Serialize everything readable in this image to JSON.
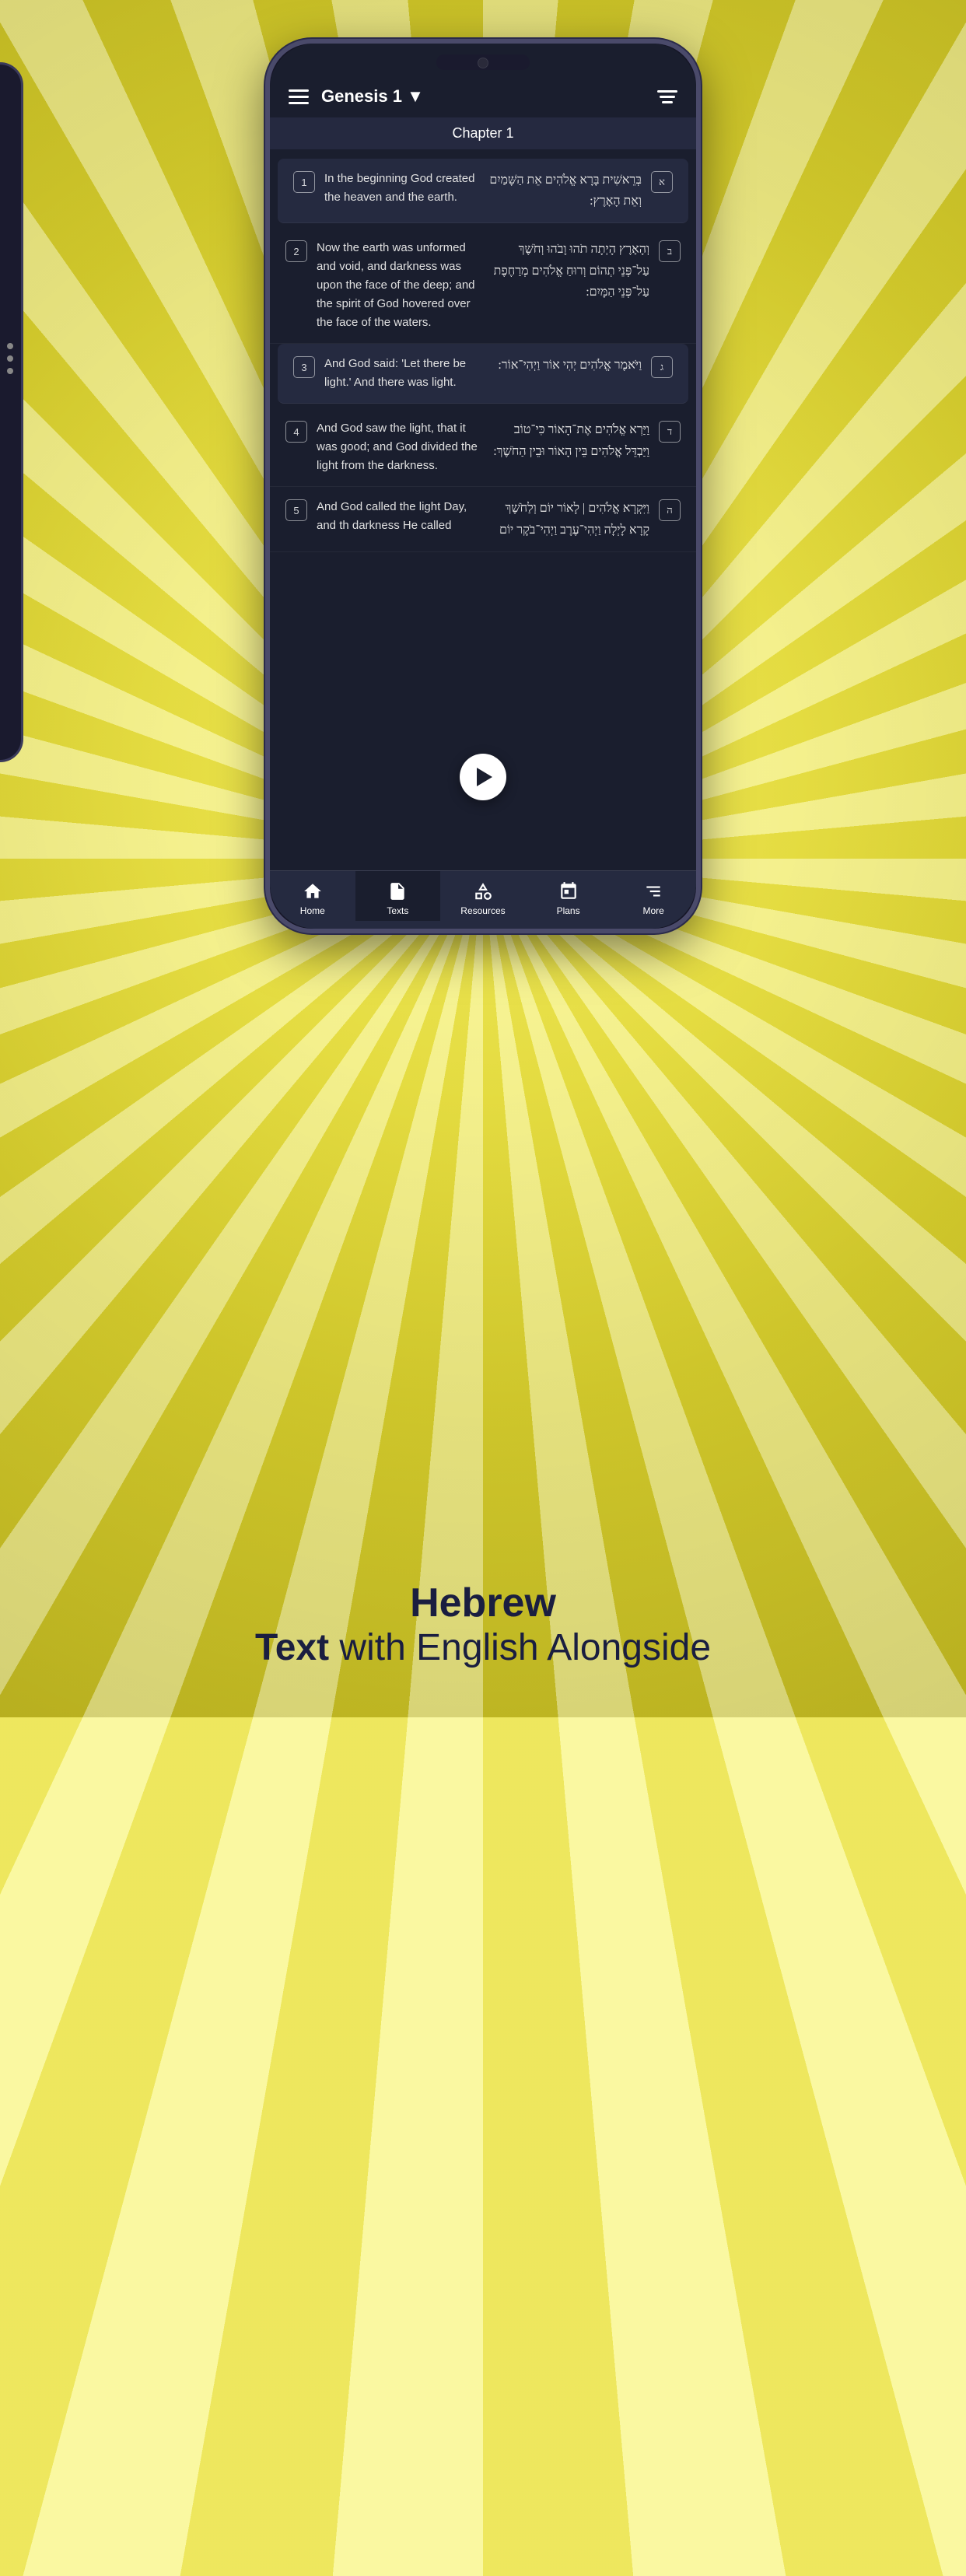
{
  "background": {
    "color": "#f0ed5a"
  },
  "phone": {
    "header": {
      "menu_icon": "≡",
      "title": "Genesis 1",
      "dropdown_label": "Genesis 1 ▼",
      "filter_icon": "filter"
    },
    "chapter": {
      "label": "Chapter 1"
    },
    "verses": [
      {
        "number": "1",
        "hebrew_letter": "א",
        "english": "In the beginning God created the heaven and the earth.",
        "hebrew": "בְּרֵאשִׁית בָּרָא אֱלֹהִים אֵת הַשָּׁמַיִם וְאֵת הָאָרֶץ:",
        "highlighted": true
      },
      {
        "number": "2",
        "hebrew_letter": "ב",
        "english": "Now the earth was unformed and void, and darkness was upon the face of the deep; and the spirit of God hovered over the face of the waters.",
        "hebrew": "וְהָאָרֶץ הָיְתָה תֹהוּ וָבֹהוּ וְחֹשֶׁךְ עַל־פְּנֵי תְהוֹם וְרוּחַ אֱלֹהִים מְרַחֶפֶת עַל־פְּנֵי הַמָּיִם:",
        "highlighted": false
      },
      {
        "number": "3",
        "hebrew_letter": "ג",
        "english": "And God said: 'Let there be light.' And there was light.",
        "hebrew": "וַיֹּאמֶר אֱלֹהִים יְהִי אוֹר וַיְהִי־אוֹר:",
        "highlighted": true
      },
      {
        "number": "4",
        "hebrew_letter": "ד",
        "english": "And God saw the light, that it was good; and God divided the light from the darkness.",
        "hebrew": "וַיַּרְא אֱלֹהִים אֶת־הָאוֹר כִּי־טוֹב וַיַּבְדֵּל אֱלֹהִים בֵּין הָאוֹר וּבֵין הַחֹשֶׁךְ:",
        "highlighted": false
      },
      {
        "number": "5",
        "hebrew_letter": "ה",
        "english": "And God called the light Day, and th darkness He called",
        "hebrew": "וַיִּקְרָא אֱלֹהִים | לָאוֹר יוֹם וְלַחֹשֶׁךְ קָרָא לָיְלָה וַיְהִי־עֶרֶב וַיְהִי־בֹקֶר יוֹם",
        "highlighted": false
      }
    ],
    "nav": [
      {
        "label": "Home",
        "icon": "home",
        "active": false
      },
      {
        "label": "Texts",
        "icon": "texts",
        "active": true
      },
      {
        "label": "Resources",
        "icon": "resources",
        "active": false
      },
      {
        "label": "Plans",
        "icon": "plans",
        "active": false
      },
      {
        "label": "More",
        "icon": "more",
        "active": false
      }
    ]
  },
  "bottom_text": {
    "line1": "Hebrew",
    "line2_bold": "Text",
    "line2_rest": " with English Alongside"
  }
}
